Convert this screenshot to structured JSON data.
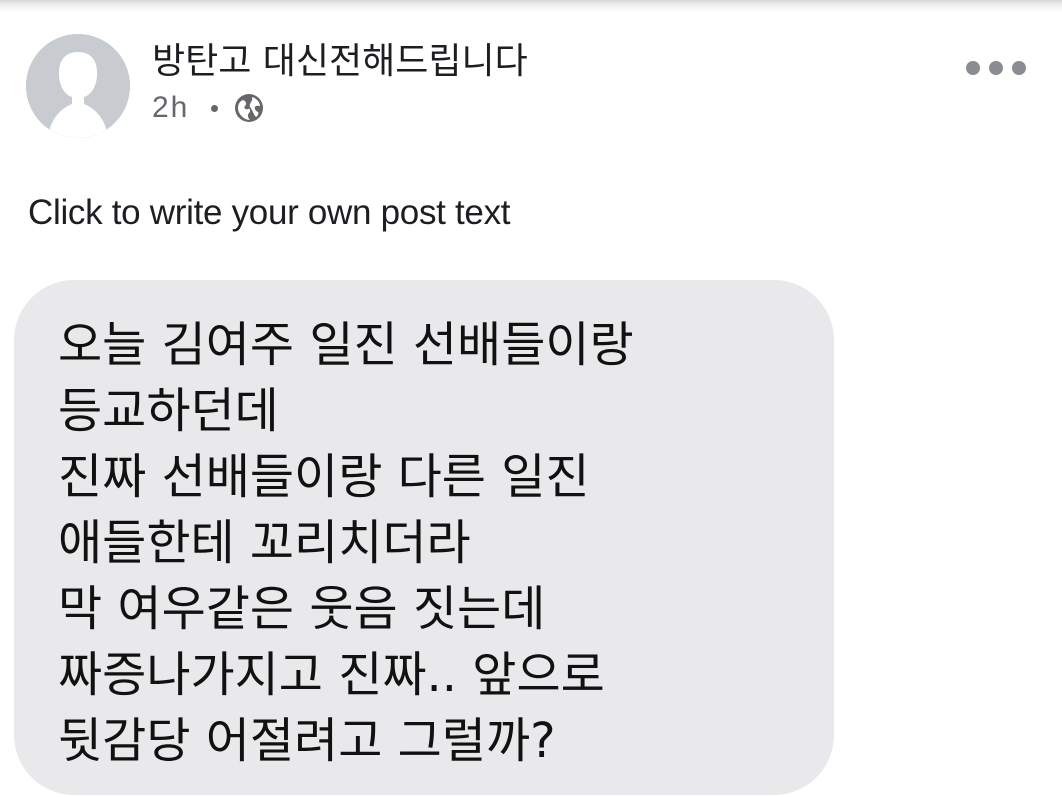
{
  "post": {
    "author_name": "방탄고 대신전해드립니다",
    "time": "2h",
    "privacy_icon": "globe-icon",
    "more_icon": "ellipsis-icon",
    "text": "Click to write your own post text"
  },
  "message": {
    "lines": [
      "오늘 김여주 일진 선배들이랑",
      "등교하던데",
      "진짜 선배들이랑 다른 일진",
      "애들한테 꼬리치더라",
      "막 여우같은 웃음 짓는데",
      "짜증나가지고 진짜.. 앞으로",
      "뒷감당 어절려고 그럴까?"
    ]
  },
  "colors": {
    "bubble_background": "#e9e9eb",
    "avatar_background": "#c8ccd1",
    "secondary_text": "#65676b",
    "primary_text": "#1c1e21"
  }
}
